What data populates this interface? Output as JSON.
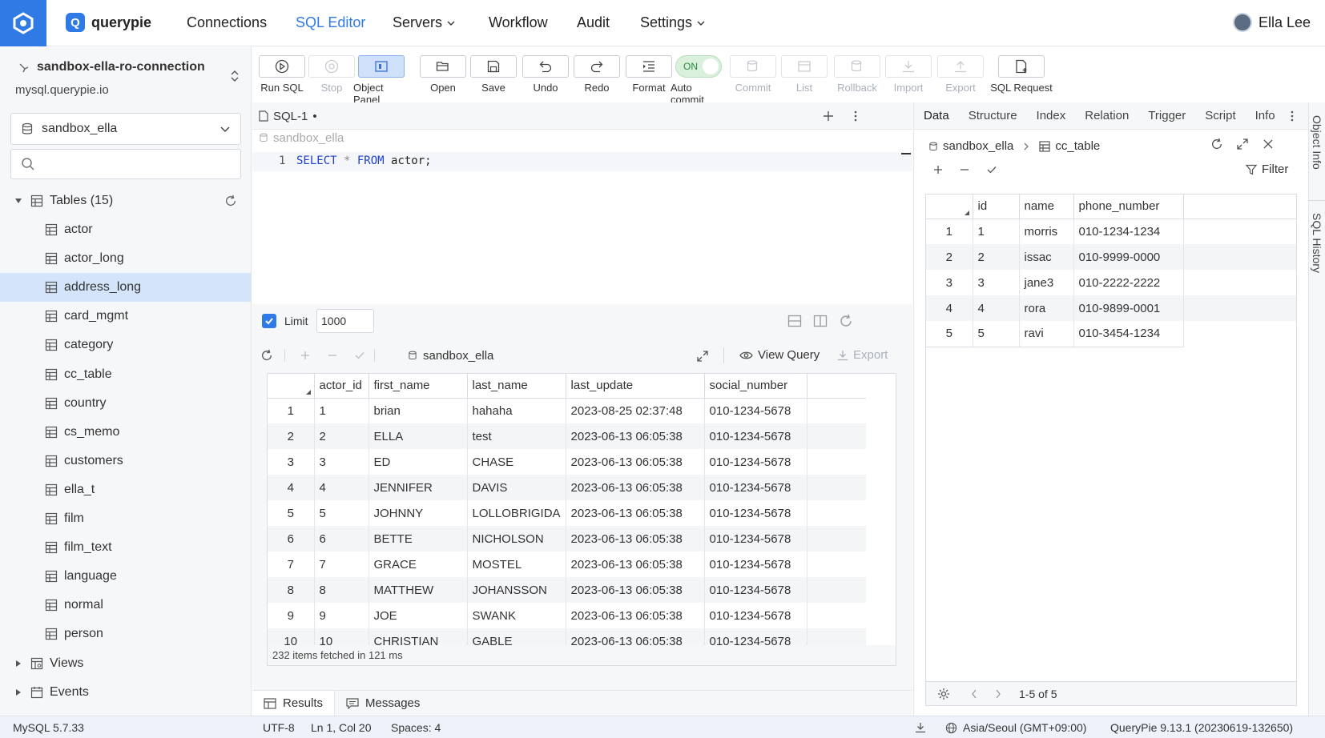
{
  "nav": {
    "brand": "querypie",
    "items": [
      {
        "label": "Connections"
      },
      {
        "label": "SQL Editor"
      },
      {
        "label": "Servers"
      },
      {
        "label": "Workflow"
      },
      {
        "label": "Audit"
      },
      {
        "label": "Settings"
      }
    ],
    "active_item": "SQL Editor",
    "user": "Ella Lee"
  },
  "sidebar": {
    "connection_name": "sandbox-ella-ro-connection",
    "connection_host": "mysql.querypie.io",
    "database": "sandbox_ella",
    "search_placeholder": "",
    "tables_header": "Tables (15)",
    "tables": [
      "actor",
      "actor_long",
      "address_long",
      "card_mgmt",
      "category",
      "cc_table",
      "country",
      "cs_memo",
      "customers",
      "ella_t",
      "film",
      "film_text",
      "language",
      "normal",
      "person"
    ],
    "selected_table": "address_long",
    "views_label": "Views",
    "events_label": "Events"
  },
  "toolbar": {
    "buttons": [
      {
        "label": "Run SQL",
        "icon": "play-icon",
        "state": "enabled"
      },
      {
        "label": "Stop",
        "icon": "stop-icon",
        "state": "disabled"
      },
      {
        "label": "Object Panel",
        "icon": "panel-icon",
        "state": "active"
      },
      {
        "label": "Open",
        "icon": "folder-icon",
        "state": "enabled"
      },
      {
        "label": "Save",
        "icon": "save-icon",
        "state": "enabled"
      },
      {
        "label": "Undo",
        "icon": "undo-icon",
        "state": "enabled"
      },
      {
        "label": "Redo",
        "icon": "redo-icon",
        "state": "enabled"
      },
      {
        "label": "Format",
        "icon": "format-icon",
        "state": "enabled"
      },
      {
        "label": "Auto commit",
        "icon": "toggle",
        "state": "on"
      },
      {
        "label": "Commit",
        "icon": "commit-icon",
        "state": "disabled"
      },
      {
        "label": "List",
        "icon": "list-icon",
        "state": "disabled"
      },
      {
        "label": "Rollback",
        "icon": "rollback-icon",
        "state": "disabled"
      },
      {
        "label": "Import",
        "icon": "import-icon",
        "state": "disabled"
      },
      {
        "label": "Export",
        "icon": "export-icon",
        "state": "disabled"
      },
      {
        "label": "SQL Request",
        "icon": "sql-request-icon",
        "state": "enabled"
      }
    ],
    "autocommit_text": "ON"
  },
  "editor": {
    "tab_label": "SQL-1",
    "tab_modified": "•",
    "db_hint": "sandbox_ella",
    "line_number": "1",
    "code": {
      "kw1": "SELECT",
      "star": " * ",
      "kw2": "FROM",
      "rest": " actor;"
    },
    "limit_label": "Limit",
    "limit_value": "1000"
  },
  "results": {
    "db": "sandbox_ella",
    "view_query": "View Query",
    "export": "Export",
    "columns": [
      "actor_id",
      "first_name",
      "last_name",
      "last_update",
      "social_number"
    ],
    "rows": [
      [
        "1",
        "1",
        "brian",
        "hahaha",
        "2023-08-25 02:37:48",
        "010-1234-5678"
      ],
      [
        "2",
        "2",
        "ELLA",
        "test",
        "2023-06-13 06:05:38",
        "010-1234-5678"
      ],
      [
        "3",
        "3",
        "ED",
        "CHASE",
        "2023-06-13 06:05:38",
        "010-1234-5678"
      ],
      [
        "4",
        "4",
        "JENNIFER",
        "DAVIS",
        "2023-06-13 06:05:38",
        "010-1234-5678"
      ],
      [
        "5",
        "5",
        "JOHNNY",
        "LOLLOBRIGIDA",
        "2023-06-13 06:05:38",
        "010-1234-5678"
      ],
      [
        "6",
        "6",
        "BETTE",
        "NICHOLSON",
        "2023-06-13 06:05:38",
        "010-1234-5678"
      ],
      [
        "7",
        "7",
        "GRACE",
        "MOSTEL",
        "2023-06-13 06:05:38",
        "010-1234-5678"
      ],
      [
        "8",
        "8",
        "MATTHEW",
        "JOHANSSON",
        "2023-06-13 06:05:38",
        "010-1234-5678"
      ],
      [
        "9",
        "9",
        "JOE",
        "SWANK",
        "2023-06-13 06:05:38",
        "010-1234-5678"
      ],
      [
        "10",
        "10",
        "CHRISTIAN",
        "GABLE",
        "2023-06-13 06:05:38",
        "010-1234-5678"
      ]
    ],
    "footer": "232 items fetched in 121 ms",
    "tab_results": "Results",
    "tab_messages": "Messages"
  },
  "object_panel": {
    "tabs": [
      "Data",
      "Structure",
      "Index",
      "Relation",
      "Trigger",
      "Script",
      "Info"
    ],
    "active_tab": "Data",
    "crumb_db": "sandbox_ella",
    "crumb_table": "cc_table",
    "filter_label": "Filter",
    "columns": [
      "id",
      "name",
      "phone_number"
    ],
    "rows": [
      [
        "1",
        "1",
        "morris",
        "010-1234-1234"
      ],
      [
        "2",
        "2",
        "issac",
        "010-9999-0000"
      ],
      [
        "3",
        "3",
        "jane3",
        "010-2222-2222"
      ],
      [
        "4",
        "4",
        "rora",
        "010-9899-0001"
      ],
      [
        "5",
        "5",
        "ravi",
        "010-3454-1234"
      ]
    ],
    "pagination": "1-5 of 5",
    "side_tabs": [
      "Object Info",
      "SQL History"
    ]
  },
  "status": {
    "db_version": "MySQL 5.7.33",
    "encoding": "UTF-8",
    "cursor": "Ln 1, Col 20",
    "spaces": "Spaces: 4",
    "timezone": "Asia/Seoul (GMT+09:00)",
    "version": "QueryPie 9.13.1 (20230619-132650)"
  },
  "colors": {
    "accent": "#2f7ae5",
    "selected_row": "#d4e5fb",
    "keyword": "#1f3fd0"
  }
}
